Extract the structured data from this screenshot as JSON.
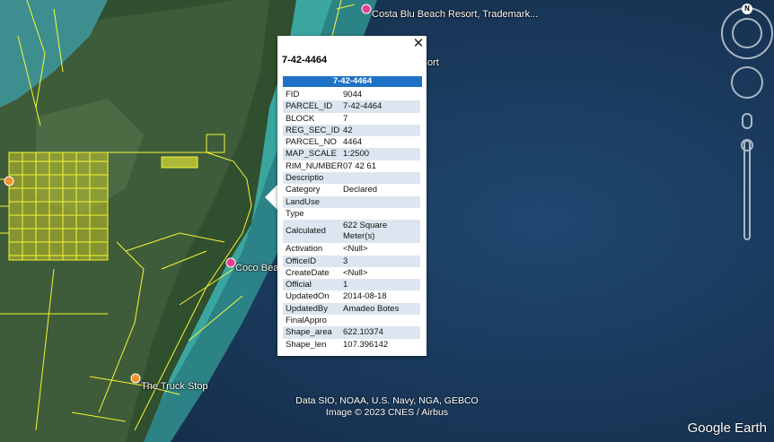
{
  "map": {
    "places": [
      {
        "name": "Costa Blu Beach Resort, Trademark..."
      },
      {
        "name": "Coco Bea"
      },
      {
        "name": "The Truck Stop"
      },
      {
        "name": "ort"
      }
    ],
    "attribution_line1": "Data SIO, NOAA, U.S. Navy, NGA, GEBCO",
    "attribution_line2": "Image © 2023 CNES / Airbus",
    "brand": "Google Earth",
    "compass_label": "N"
  },
  "popup": {
    "title": "7-42-4464",
    "header": "7-42-4464",
    "close_icon": "close-icon",
    "rows": [
      {
        "key": "FID",
        "value": "9044"
      },
      {
        "key": "PARCEL_ID",
        "value": "7-42-4464"
      },
      {
        "key": "BLOCK",
        "value": "7"
      },
      {
        "key": "REG_SEC_ID",
        "value": "42"
      },
      {
        "key": "PARCEL_NO",
        "value": "4464"
      },
      {
        "key": "MAP_SCALE",
        "value": "1:2500"
      },
      {
        "key": "RIM_NUMBER",
        "value": "07 42 61"
      },
      {
        "key": "Descriptio",
        "value": ""
      },
      {
        "key": "Category",
        "value": "Declared"
      },
      {
        "key": "LandUse",
        "value": ""
      },
      {
        "key": "Type",
        "value": ""
      },
      {
        "key": "Calculated",
        "value": "622 Square Meter(s)"
      },
      {
        "key": "Activation",
        "value": "<Null>"
      },
      {
        "key": "OfficeID",
        "value": "3"
      },
      {
        "key": "CreateDate",
        "value": "<Null>"
      },
      {
        "key": "Official",
        "value": "1"
      },
      {
        "key": "UpdatedOn",
        "value": "2014-08-18"
      },
      {
        "key": "UpdatedBy",
        "value": "Amadeo Botes"
      },
      {
        "key": "FinalAppro",
        "value": ""
      },
      {
        "key": "Shape_area",
        "value": "622.10374"
      },
      {
        "key": "Shape_len",
        "value": "107.396142"
      }
    ]
  },
  "colors": {
    "sea": "#1c3a5a",
    "reef": "#3fa6a0",
    "land": "#3c5b3a",
    "parcel": "#ffff33",
    "header": "#1e72c6"
  }
}
